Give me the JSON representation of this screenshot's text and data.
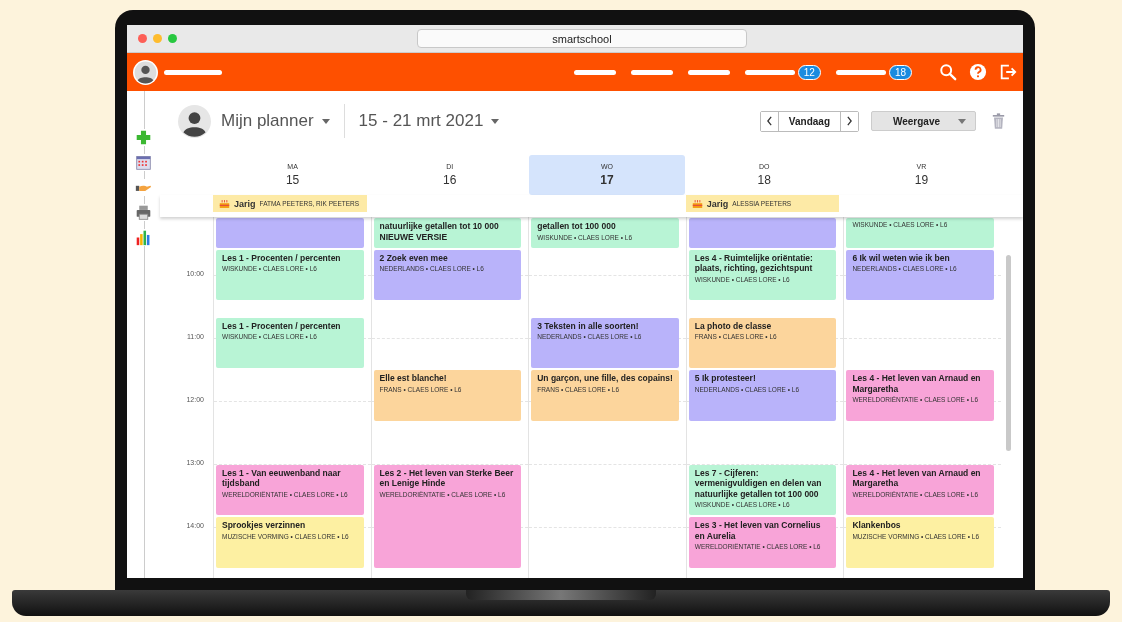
{
  "browser": {
    "url": "smartschool"
  },
  "nav_items": [
    {
      "kind": "link"
    },
    {
      "kind": "link"
    },
    {
      "kind": "link"
    },
    {
      "kind": "link_with_badge",
      "badge": "12"
    },
    {
      "kind": "link_with_badge",
      "badge": "18"
    }
  ],
  "planner": {
    "title": "Mijn planner",
    "range": "15 - 21 mrt 2021",
    "today_button": "Vandaag",
    "view_button": "Weergave"
  },
  "hours": [
    "10:00",
    "11:00",
    "12:00",
    "13:00",
    "14:00"
  ],
  "days": [
    {
      "weekday": "MA",
      "date": "15",
      "selected": false,
      "all_day": {
        "label": "Jarig",
        "names": "FATMA PEETERS, RIK PEETERS"
      },
      "slots": [
        {
          "kind": "lesson",
          "color": "#b9b3fa"
        },
        {
          "kind": "lesson",
          "color": "#b8f4d5",
          "title": "Les 1 - Procenten / percenten",
          "meta": "WISKUNDE • CLAES LORE • L6"
        },
        {
          "kind": "lesson",
          "color": "#b8f4d5",
          "title": "Les 1 - Procenten / percenten",
          "meta": "WISKUNDE • CLAES LORE • L6"
        },
        {
          "kind": "free"
        },
        {
          "kind": "lesson",
          "color": "#f8a4d8",
          "title": "Les 1 - Van eeuwenband naar tijdsband",
          "meta": "WERELDORIËNTATIE • CLAES LORE • L6"
        },
        {
          "kind": "lesson",
          "color": "#fdf0a2",
          "title": "Sprookjes verzinnen",
          "meta": "MUZISCHE VORMING • CLAES LORE • L6"
        }
      ]
    },
    {
      "weekday": "DI",
      "date": "16",
      "selected": false,
      "slots": [
        {
          "kind": "lesson",
          "color": "#b8f4d5",
          "title": "natuurlijke getallen tot 10 000 NIEUWE VERSIE"
        },
        {
          "kind": "lesson",
          "color": "#b9b3fa",
          "title": "2 Zoek even mee",
          "meta": "NEDERLANDS • CLAES LORE • L6"
        },
        {
          "kind": "free"
        },
        {
          "kind": "lesson",
          "color": "#fcd59c",
          "title": "Elle est blanche!",
          "meta": "FRANS • CLAES LORE • L6"
        },
        {
          "kind": "lesson",
          "color": "#f8a4d8",
          "title": "Les 2 - Het leven van Sterke Beer en Lenige Hinde",
          "meta": "WERELDORIËNTATIE • CLAES LORE • L6"
        },
        {
          "kind": "continued"
        }
      ]
    },
    {
      "weekday": "WO",
      "date": "17",
      "selected": true,
      "slots": [
        {
          "kind": "lesson",
          "color": "#b8f4d5",
          "title": "getallen tot 100 000",
          "meta": "WISKUNDE • CLAES LORE • L6"
        },
        {
          "kind": "free"
        },
        {
          "kind": "lesson",
          "color": "#b9b3fa",
          "title": "3 Teksten in alle soorten!",
          "meta": "NEDERLANDS • CLAES LORE • L6"
        },
        {
          "kind": "lesson",
          "color": "#fcd59c",
          "title": "Un garçon, une fille, des copains!",
          "meta": "FRANS • CLAES LORE • L6"
        },
        {
          "kind": "free"
        },
        {
          "kind": "free"
        }
      ]
    },
    {
      "weekday": "DO",
      "date": "18",
      "selected": false,
      "all_day": {
        "label": "Jarig",
        "names": "ALESSIA PEETERS"
      },
      "slots": [
        {
          "kind": "lesson",
          "color": "#b9b3fa"
        },
        {
          "kind": "lesson",
          "color": "#b8f4d5",
          "title": "Les 4 - Ruimtelijke oriëntatie: plaats, richting, gezichtspunt",
          "meta": "WISKUNDE • CLAES LORE • L6"
        },
        {
          "kind": "lesson",
          "color": "#fcd59c",
          "title": "La photo de classe",
          "meta": "FRANS • CLAES LORE • L6"
        },
        {
          "kind": "lesson",
          "color": "#b9b3fa",
          "title": "5 Ik protesteer!",
          "meta": "NEDERLANDS • CLAES LORE • L6"
        },
        {
          "kind": "lesson",
          "color": "#b8f4d5",
          "title": "Les 7 - Cijferen: vermenigvuldigen en delen van natuurlijke getallen tot 100 000",
          "meta": "WISKUNDE • CLAES LORE • L6"
        },
        {
          "kind": "lesson",
          "color": "#f8a4d8",
          "title": "Les 3 - Het leven van Cornelius en Aurelia",
          "meta": "WERELDORIËNTATIE • CLAES LORE • L6"
        }
      ]
    },
    {
      "weekday": "VR",
      "date": "19",
      "selected": false,
      "slots": [
        {
          "kind": "lesson",
          "color": "#b8f4d5",
          "meta": "WISKUNDE • CLAES LORE • L6"
        },
        {
          "kind": "lesson",
          "color": "#b9b3fa",
          "title": "6 Ik wil weten wie ik ben",
          "meta": "NEDERLANDS • CLAES LORE • L6"
        },
        {
          "kind": "free"
        },
        {
          "kind": "lesson",
          "color": "#f8a4d8",
          "title": "Les 4 - Het leven van Arnaud en Margaretha",
          "meta": "WERELDORIËNTATIE • CLAES LORE • L6"
        },
        {
          "kind": "lesson",
          "color": "#f8a4d8",
          "title": "Les 4 - Het leven van Arnaud en Margaretha",
          "meta": "WERELDORIËNTATIE • CLAES LORE • L6"
        },
        {
          "kind": "lesson",
          "color": "#fdf0a2",
          "title": "Klankenbos",
          "meta": "MUZISCHE VORMING • CLAES LORE • L6"
        }
      ]
    }
  ]
}
